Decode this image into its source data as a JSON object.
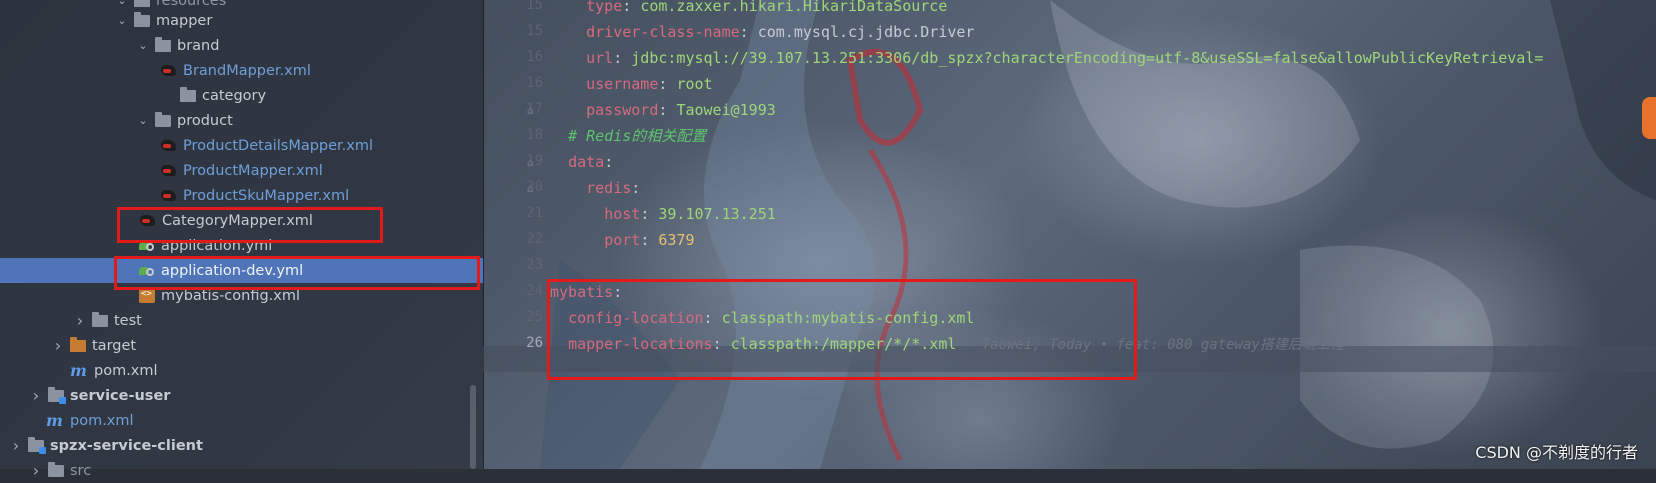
{
  "tree": {
    "rows": [
      {
        "label": "resources",
        "type": "folder",
        "indent": 0,
        "arrow": "down",
        "partial": true
      },
      {
        "label": "mapper",
        "type": "folder",
        "arrow": "down"
      },
      {
        "label": "brand",
        "type": "folder",
        "arrow": "down"
      },
      {
        "label": "BrandMapper.xml",
        "type": "mapper-xml"
      },
      {
        "label": "category",
        "type": "folder",
        "arrow": ""
      },
      {
        "label": "product",
        "type": "folder",
        "arrow": "down"
      },
      {
        "label": "ProductDetailsMapper.xml",
        "type": "mapper-xml"
      },
      {
        "label": "ProductMapper.xml",
        "type": "mapper-xml"
      },
      {
        "label": "ProductSkuMapper.xml",
        "type": "mapper-xml"
      },
      {
        "label": "CategoryMapper.xml",
        "type": "mapper-xml-plain"
      },
      {
        "label": "application.yml",
        "type": "yml"
      },
      {
        "label": "application-dev.yml",
        "type": "yml",
        "selected": true
      },
      {
        "label": "mybatis-config.xml",
        "type": "config-xml"
      },
      {
        "label": "test",
        "type": "folder",
        "arrow": "right"
      },
      {
        "label": "target",
        "type": "folder-orange",
        "arrow": "right"
      },
      {
        "label": "pom.xml",
        "type": "pom"
      },
      {
        "label": "service-user",
        "type": "module",
        "arrow": "right",
        "bold": true
      },
      {
        "label": "pom.xml",
        "type": "pom-root"
      },
      {
        "label": "spzx-service-client",
        "type": "module",
        "arrow": "right",
        "bold": true
      },
      {
        "label": "src",
        "type": "folder",
        "arrow": "right",
        "partial": true
      }
    ]
  },
  "editor": {
    "line_numbers": [
      "15",
      "16",
      "16",
      "16",
      "17",
      "18",
      "19",
      "20",
      "21",
      "22",
      "23",
      "24",
      "25",
      "26"
    ],
    "gutter": [
      "",
      "",
      "",
      "",
      "",
      "",
      "",
      "",
      "",
      "",
      "",
      "",
      "",
      ""
    ],
    "lines": [
      {
        "num": "",
        "parts": [
          {
            "t": "    ",
            "c": "p"
          },
          {
            "t": "type",
            "c": "k"
          },
          {
            "t": ": ",
            "c": "p"
          },
          {
            "t": "com.zaxxer.hikari.HikariDataSource",
            "c": "v"
          }
        ]
      },
      {
        "num": "",
        "parts": [
          {
            "t": "    ",
            "c": "p"
          },
          {
            "t": "driver-class-name",
            "c": "k"
          },
          {
            "t": ": ",
            "c": "p"
          },
          {
            "t": "com.mysql.cj.jdbc.Driver",
            "c": "p"
          }
        ]
      },
      {
        "num": "",
        "parts": [
          {
            "t": "    ",
            "c": "p"
          },
          {
            "t": "url",
            "c": "k"
          },
          {
            "t": ": ",
            "c": "p"
          },
          {
            "t": "jdbc:mysql://39.107.13.251:3306/db_spzx?characterEncoding=utf-8&useSSL=false&allowPublicKeyRetrieval=",
            "c": "v"
          }
        ]
      },
      {
        "num": "",
        "parts": [
          {
            "t": "    ",
            "c": "p"
          },
          {
            "t": "username",
            "c": "k"
          },
          {
            "t": ": ",
            "c": "p"
          },
          {
            "t": "root",
            "c": "v"
          }
        ]
      },
      {
        "num": "",
        "parts": [
          {
            "t": "    ",
            "c": "p"
          },
          {
            "t": "password",
            "c": "k"
          },
          {
            "t": ": ",
            "c": "p"
          },
          {
            "t": "Taowei@1993",
            "c": "v"
          }
        ]
      },
      {
        "num": "",
        "parts": [
          {
            "t": "  ",
            "c": "p"
          },
          {
            "t": "# Redis的相关配置",
            "c": "c"
          }
        ]
      },
      {
        "num": "",
        "parts": [
          {
            "t": "  ",
            "c": "p"
          },
          {
            "t": "data",
            "c": "k"
          },
          {
            "t": ":",
            "c": "p"
          }
        ]
      },
      {
        "num": "",
        "parts": [
          {
            "t": "    ",
            "c": "p"
          },
          {
            "t": "redis",
            "c": "k"
          },
          {
            "t": ":",
            "c": "p"
          }
        ]
      },
      {
        "num": "",
        "parts": [
          {
            "t": "      ",
            "c": "p"
          },
          {
            "t": "host",
            "c": "k"
          },
          {
            "t": ": ",
            "c": "p"
          },
          {
            "t": "39.107.13.251",
            "c": "v"
          }
        ]
      },
      {
        "num": "",
        "parts": [
          {
            "t": "      ",
            "c": "p"
          },
          {
            "t": "port",
            "c": "k"
          },
          {
            "t": ": ",
            "c": "p"
          },
          {
            "t": "6379",
            "c": "n"
          }
        ]
      },
      {
        "num": "",
        "parts": []
      },
      {
        "num": "",
        "parts": [
          {
            "t": "mybatis",
            "c": "k"
          },
          {
            "t": ":",
            "c": "p"
          }
        ]
      },
      {
        "num": "",
        "parts": [
          {
            "t": "  ",
            "c": "p"
          },
          {
            "t": "config-location",
            "c": "k"
          },
          {
            "t": ": ",
            "c": "p"
          },
          {
            "t": "classpath:mybatis-config.xml",
            "c": "v"
          }
        ]
      },
      {
        "num": "",
        "parts": [
          {
            "t": "  ",
            "c": "p"
          },
          {
            "t": "mapper-locations",
            "c": "k"
          },
          {
            "t": ": ",
            "c": "p"
          },
          {
            "t": "classpath:/mapper/*/*.xml",
            "c": "v"
          },
          {
            "t": "   Taowei, Today • feat: 080 gateway搭建后端工程",
            "c": "blame"
          }
        ]
      }
    ]
  },
  "watermark": "CSDN @不剃度的行者",
  "colors": {
    "highlight_box": "#e21a1a",
    "selection": "#4f74b7"
  }
}
